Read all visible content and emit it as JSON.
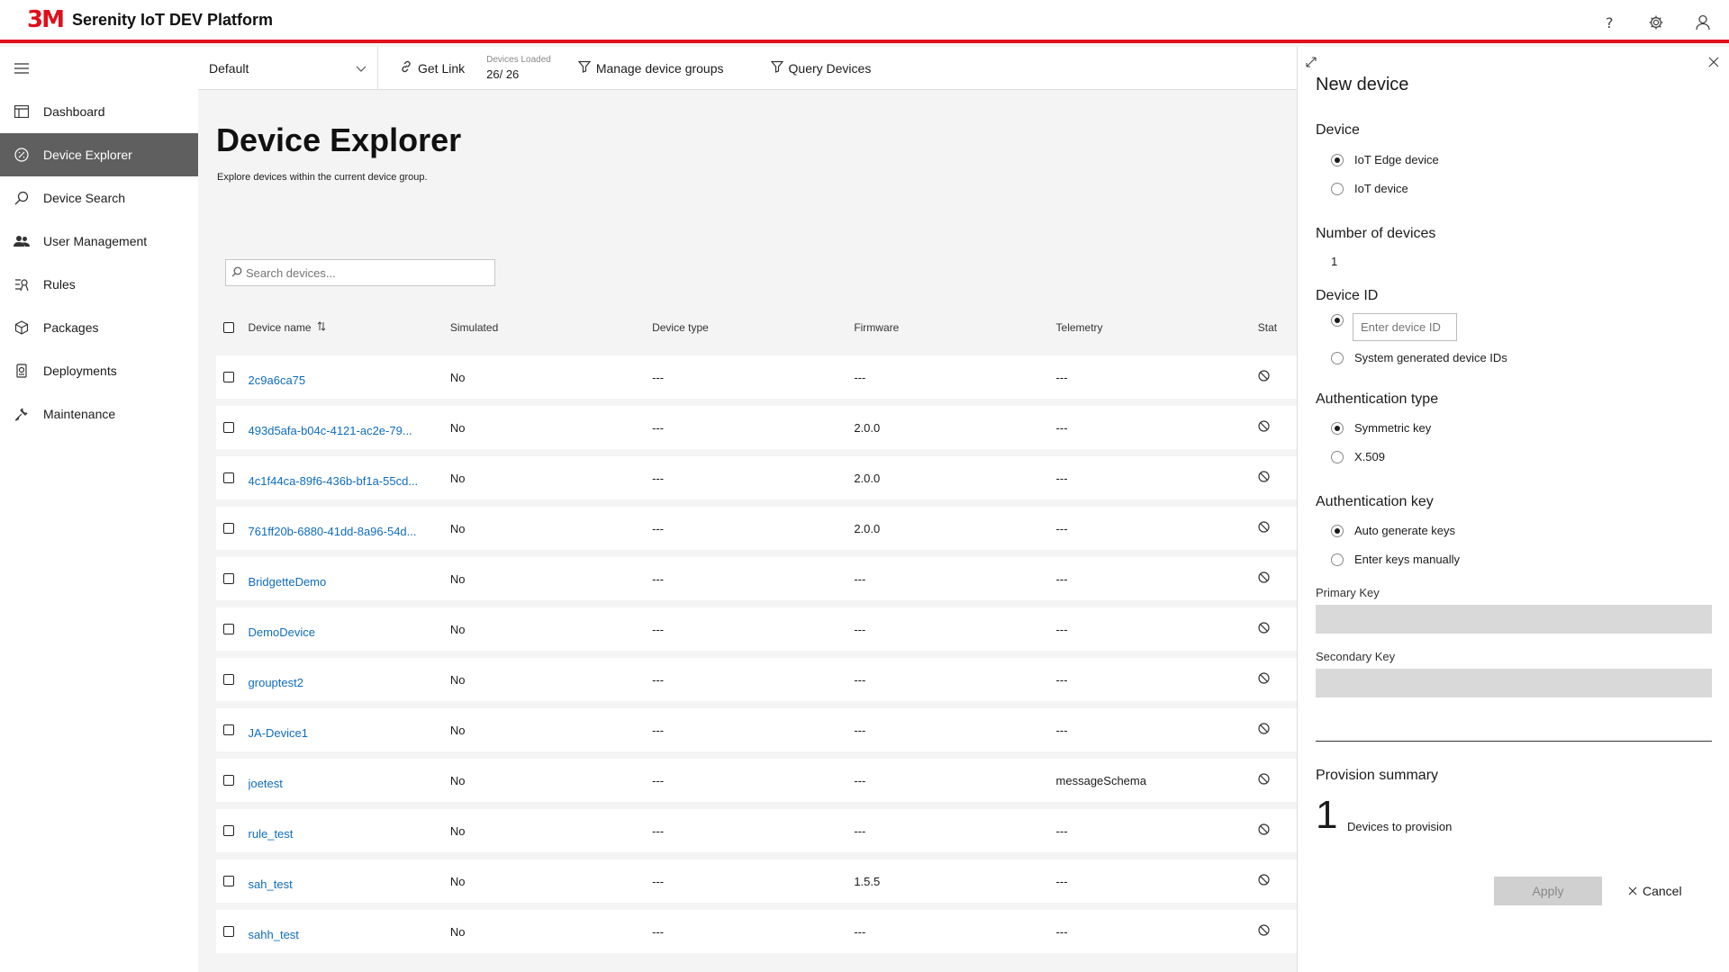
{
  "header": {
    "logo_text": "3M",
    "title": "Serenity IoT DEV Platform",
    "brand_color": "#e00f1b",
    "icons": [
      "help-icon",
      "settings-icon",
      "user-icon"
    ]
  },
  "nav": {
    "items": [
      {
        "label": "Dashboard",
        "icon": "dashboard-icon"
      },
      {
        "label": "Device Explorer",
        "icon": "device-explorer-icon"
      },
      {
        "label": "Device Search",
        "icon": "search-icon"
      },
      {
        "label": "User Management",
        "icon": "users-icon"
      },
      {
        "label": "Rules",
        "icon": "rules-icon"
      },
      {
        "label": "Packages",
        "icon": "package-icon"
      },
      {
        "label": "Deployments",
        "icon": "deployments-icon"
      },
      {
        "label": "Maintenance",
        "icon": "maintenance-icon"
      }
    ],
    "active": "Device Explorer"
  },
  "toolbar": {
    "group": "Default",
    "get_link": "Get Link",
    "devices_loaded_label": "Devices Loaded",
    "devices_loaded_value": "26/ 26",
    "manage_groups": "Manage device groups",
    "query_devices": "Query Devices"
  },
  "main": {
    "title": "Device Explorer",
    "description": "Explore devices within the current device group.",
    "search_placeholder": "Search devices...",
    "columns": {
      "name": "Device name",
      "simulated": "Simulated",
      "type": "Device type",
      "firmware": "Firmware",
      "telemetry": "Telemetry",
      "status": "Stat"
    },
    "rows": [
      {
        "name": "2c9a6ca75",
        "simulated": "No",
        "type": "---",
        "firmware": "---",
        "telemetry": "---"
      },
      {
        "name": "493d5afa-b04c-4121-ac2e-79...",
        "simulated": "No",
        "type": "---",
        "firmware": "2.0.0",
        "telemetry": "---"
      },
      {
        "name": "4c1f44ca-89f6-436b-bf1a-55cd...",
        "simulated": "No",
        "type": "---",
        "firmware": "2.0.0",
        "telemetry": "---"
      },
      {
        "name": "761ff20b-6880-41dd-8a96-54d...",
        "simulated": "No",
        "type": "---",
        "firmware": "2.0.0",
        "telemetry": "---"
      },
      {
        "name": "BridgetteDemo",
        "simulated": "No",
        "type": "---",
        "firmware": "---",
        "telemetry": "---"
      },
      {
        "name": "DemoDevice",
        "simulated": "No",
        "type": "---",
        "firmware": "---",
        "telemetry": "---"
      },
      {
        "name": "grouptest2",
        "simulated": "No",
        "type": "---",
        "firmware": "---",
        "telemetry": "---"
      },
      {
        "name": "JA-Device1",
        "simulated": "No",
        "type": "---",
        "firmware": "---",
        "telemetry": "---"
      },
      {
        "name": "joetest",
        "simulated": "No",
        "type": "---",
        "firmware": "---",
        "telemetry": "messageSchema"
      },
      {
        "name": "rule_test",
        "simulated": "No",
        "type": "---",
        "firmware": "---",
        "telemetry": "---"
      },
      {
        "name": "sah_test",
        "simulated": "No",
        "type": "---",
        "firmware": "1.5.5",
        "telemetry": "---"
      },
      {
        "name": "sahh_test",
        "simulated": "No",
        "type": "---",
        "firmware": "---",
        "telemetry": "---"
      }
    ]
  },
  "panel": {
    "title": "New device",
    "device_label": "Device",
    "device_options": [
      "IoT Edge device",
      "IoT device"
    ],
    "device_selected": 0,
    "count_label": "Number of devices",
    "count_value": "1",
    "id_label": "Device ID",
    "id_placeholder": "Enter device ID",
    "id_generated": "System generated device IDs",
    "auth_type_label": "Authentication type",
    "auth_type_options": [
      "Symmetric key",
      "X.509"
    ],
    "auth_key_label": "Authentication key",
    "auth_key_options": [
      "Auto generate keys",
      "Enter keys manually"
    ],
    "primary_key_label": "Primary Key",
    "secondary_key_label": "Secondary Key",
    "summary_label": "Provision summary",
    "summary_count": "1",
    "summary_text": "Devices to provision",
    "apply": "Apply",
    "cancel": "Cancel"
  }
}
